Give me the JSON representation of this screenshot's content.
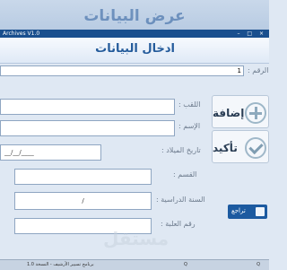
{
  "background_window": {
    "title": "عرض البيانات"
  },
  "window": {
    "title": "Archives V1.0",
    "controls": "– □ ×"
  },
  "header": {
    "title": "ادخال البيانات"
  },
  "form": {
    "id_label": "الرقم :",
    "id_value": "1",
    "surname_label": "اللقب :",
    "name_label": "الإسم :",
    "birthdate_label": "تاريخ الميلاد :",
    "birthdate_value": "__/__/____",
    "section_label": "القسم :",
    "school_year_label": "السنة الدراسية :",
    "school_year_value": "/",
    "grade_label": "رقم العلبة :"
  },
  "buttons": {
    "add": "إضافة",
    "confirm": "تأكيد",
    "back": "تراجع"
  },
  "watermark": "مستقل",
  "statusbar": {
    "left": "برنامج تسيير الأرشيف - النسخة 1.0",
    "middle": "Q",
    "right": "Q"
  }
}
